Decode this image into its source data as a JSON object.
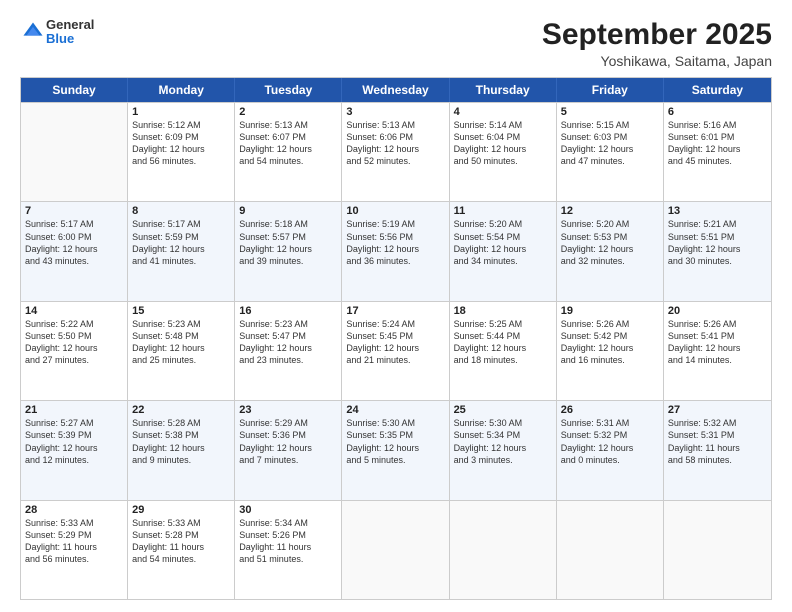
{
  "logo": {
    "general": "General",
    "blue": "Blue"
  },
  "title": {
    "month_year": "September 2025",
    "location": "Yoshikawa, Saitama, Japan"
  },
  "weekdays": [
    "Sunday",
    "Monday",
    "Tuesday",
    "Wednesday",
    "Thursday",
    "Friday",
    "Saturday"
  ],
  "rows": [
    [
      {
        "day": "",
        "info": ""
      },
      {
        "day": "1",
        "info": "Sunrise: 5:12 AM\nSunset: 6:09 PM\nDaylight: 12 hours\nand 56 minutes."
      },
      {
        "day": "2",
        "info": "Sunrise: 5:13 AM\nSunset: 6:07 PM\nDaylight: 12 hours\nand 54 minutes."
      },
      {
        "day": "3",
        "info": "Sunrise: 5:13 AM\nSunset: 6:06 PM\nDaylight: 12 hours\nand 52 minutes."
      },
      {
        "day": "4",
        "info": "Sunrise: 5:14 AM\nSunset: 6:04 PM\nDaylight: 12 hours\nand 50 minutes."
      },
      {
        "day": "5",
        "info": "Sunrise: 5:15 AM\nSunset: 6:03 PM\nDaylight: 12 hours\nand 47 minutes."
      },
      {
        "day": "6",
        "info": "Sunrise: 5:16 AM\nSunset: 6:01 PM\nDaylight: 12 hours\nand 45 minutes."
      }
    ],
    [
      {
        "day": "7",
        "info": "Sunrise: 5:17 AM\nSunset: 6:00 PM\nDaylight: 12 hours\nand 43 minutes."
      },
      {
        "day": "8",
        "info": "Sunrise: 5:17 AM\nSunset: 5:59 PM\nDaylight: 12 hours\nand 41 minutes."
      },
      {
        "day": "9",
        "info": "Sunrise: 5:18 AM\nSunset: 5:57 PM\nDaylight: 12 hours\nand 39 minutes."
      },
      {
        "day": "10",
        "info": "Sunrise: 5:19 AM\nSunset: 5:56 PM\nDaylight: 12 hours\nand 36 minutes."
      },
      {
        "day": "11",
        "info": "Sunrise: 5:20 AM\nSunset: 5:54 PM\nDaylight: 12 hours\nand 34 minutes."
      },
      {
        "day": "12",
        "info": "Sunrise: 5:20 AM\nSunset: 5:53 PM\nDaylight: 12 hours\nand 32 minutes."
      },
      {
        "day": "13",
        "info": "Sunrise: 5:21 AM\nSunset: 5:51 PM\nDaylight: 12 hours\nand 30 minutes."
      }
    ],
    [
      {
        "day": "14",
        "info": "Sunrise: 5:22 AM\nSunset: 5:50 PM\nDaylight: 12 hours\nand 27 minutes."
      },
      {
        "day": "15",
        "info": "Sunrise: 5:23 AM\nSunset: 5:48 PM\nDaylight: 12 hours\nand 25 minutes."
      },
      {
        "day": "16",
        "info": "Sunrise: 5:23 AM\nSunset: 5:47 PM\nDaylight: 12 hours\nand 23 minutes."
      },
      {
        "day": "17",
        "info": "Sunrise: 5:24 AM\nSunset: 5:45 PM\nDaylight: 12 hours\nand 21 minutes."
      },
      {
        "day": "18",
        "info": "Sunrise: 5:25 AM\nSunset: 5:44 PM\nDaylight: 12 hours\nand 18 minutes."
      },
      {
        "day": "19",
        "info": "Sunrise: 5:26 AM\nSunset: 5:42 PM\nDaylight: 12 hours\nand 16 minutes."
      },
      {
        "day": "20",
        "info": "Sunrise: 5:26 AM\nSunset: 5:41 PM\nDaylight: 12 hours\nand 14 minutes."
      }
    ],
    [
      {
        "day": "21",
        "info": "Sunrise: 5:27 AM\nSunset: 5:39 PM\nDaylight: 12 hours\nand 12 minutes."
      },
      {
        "day": "22",
        "info": "Sunrise: 5:28 AM\nSunset: 5:38 PM\nDaylight: 12 hours\nand 9 minutes."
      },
      {
        "day": "23",
        "info": "Sunrise: 5:29 AM\nSunset: 5:36 PM\nDaylight: 12 hours\nand 7 minutes."
      },
      {
        "day": "24",
        "info": "Sunrise: 5:30 AM\nSunset: 5:35 PM\nDaylight: 12 hours\nand 5 minutes."
      },
      {
        "day": "25",
        "info": "Sunrise: 5:30 AM\nSunset: 5:34 PM\nDaylight: 12 hours\nand 3 minutes."
      },
      {
        "day": "26",
        "info": "Sunrise: 5:31 AM\nSunset: 5:32 PM\nDaylight: 12 hours\nand 0 minutes."
      },
      {
        "day": "27",
        "info": "Sunrise: 5:32 AM\nSunset: 5:31 PM\nDaylight: 11 hours\nand 58 minutes."
      }
    ],
    [
      {
        "day": "28",
        "info": "Sunrise: 5:33 AM\nSunset: 5:29 PM\nDaylight: 11 hours\nand 56 minutes."
      },
      {
        "day": "29",
        "info": "Sunrise: 5:33 AM\nSunset: 5:28 PM\nDaylight: 11 hours\nand 54 minutes."
      },
      {
        "day": "30",
        "info": "Sunrise: 5:34 AM\nSunset: 5:26 PM\nDaylight: 11 hours\nand 51 minutes."
      },
      {
        "day": "",
        "info": ""
      },
      {
        "day": "",
        "info": ""
      },
      {
        "day": "",
        "info": ""
      },
      {
        "day": "",
        "info": ""
      }
    ]
  ]
}
